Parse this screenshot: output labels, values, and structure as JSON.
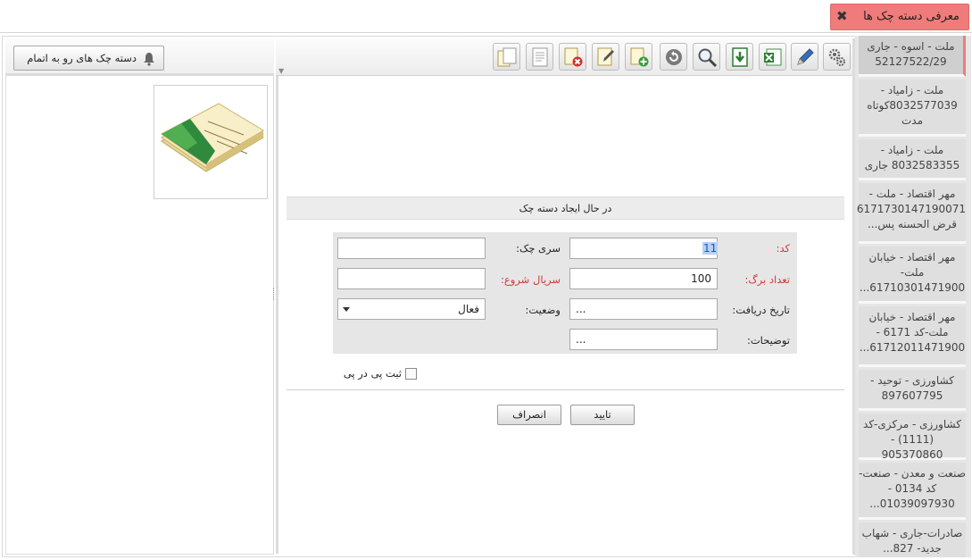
{
  "window": {
    "title": "معرفی دسته چک ها",
    "close_glyph": "✖"
  },
  "right_list": {
    "items": [
      {
        "text": "ملت - اسوه - جاری 52127522/29",
        "selected": true
      },
      {
        "text": "ملت - زامیاد - 8032577039کوتاه مدت",
        "selected": false
      },
      {
        "text": "ملت - زامیاد - 8032583355 جاری",
        "selected": false
      },
      {
        "text": "مهر اقتصاد - ملت - 6171730147190071 قرض الحسنه پس...",
        "selected": false
      },
      {
        "text": "مهر اقتصاد - خیابان ملت- 61710301471900...",
        "selected": false
      },
      {
        "text": "مهر اقتصاد - خیابان ملت-کد 6171 - 61712011471900...",
        "selected": false
      },
      {
        "text": "کشاورزی - توحید - 897607795",
        "selected": false
      },
      {
        "text": "کشاورزی - مرکزی-کد (1111) - 905370860",
        "selected": false
      },
      {
        "text": "صنعت و معدن - صنعت-کد 0134 - 01039097930...",
        "selected": false
      },
      {
        "text": "صادرات-جاری - شهاب جدید- 827...",
        "selected": false
      }
    ]
  },
  "toolbar": {
    "buttons": [
      {
        "name": "settings-icon"
      },
      {
        "name": "edit-pen-icon"
      },
      {
        "name": "excel-export-icon"
      },
      {
        "name": "download-icon"
      },
      {
        "name": "search-icon"
      },
      {
        "name": "refresh-icon"
      },
      {
        "name": "add-document-icon"
      },
      {
        "name": "edit-document-icon"
      },
      {
        "name": "delete-document-icon"
      },
      {
        "name": "view-document-icon"
      },
      {
        "name": "copy-document-icon"
      }
    ]
  },
  "form": {
    "header": "در حال ایجاد دسته چک",
    "code_label": "کد:",
    "code_value": "11",
    "series_label": "سری چک:",
    "series_value": "",
    "pages_label": "تعداد برگ:",
    "pages_value": "100",
    "start_serial_label": "سریال شروع:",
    "start_serial_value": "",
    "receive_date_label": "تاریخ دریافت:",
    "receive_date_value": "...",
    "status_label": "وضعیت:",
    "status_value": "فعال",
    "description_label": "توضیحات:",
    "description_value": "...",
    "continuous_label": "ثبت پی در پی",
    "ok_label": "تایید",
    "cancel_label": "انصراف"
  },
  "left_pane": {
    "button_label": "دسته چک های رو به اتمام"
  },
  "colors": {
    "title_tab": "#f07b7b",
    "required_label": "#d23a3a",
    "selection_highlight": "#b5d1f5"
  }
}
